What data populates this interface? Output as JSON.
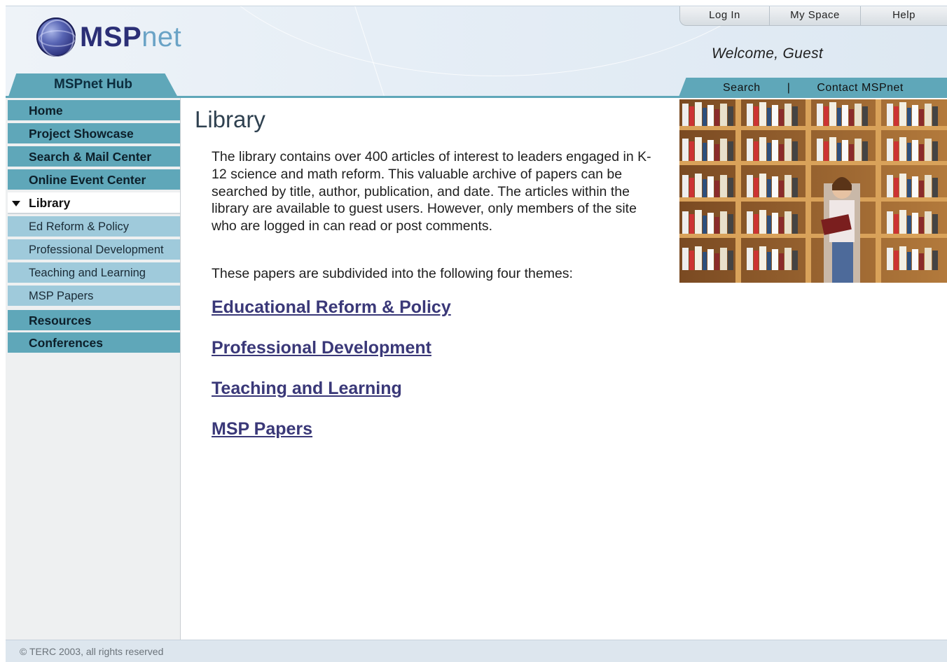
{
  "header": {
    "logo": {
      "prefix": "MSP",
      "suffix": "net"
    },
    "top_links": [
      "Log In",
      "My Space",
      "Help"
    ],
    "welcome": "Welcome, Guest",
    "hub_label": "MSPnet Hub",
    "search_label": "Search",
    "separator": "|",
    "contact_label": "Contact MSPnet"
  },
  "sidebar": {
    "items": [
      {
        "label": "Home",
        "type": "main"
      },
      {
        "label": "Project Showcase",
        "type": "main"
      },
      {
        "label": "Search & Mail Center",
        "type": "main"
      },
      {
        "label": "Online Event Center",
        "type": "main"
      },
      {
        "label": "Library",
        "type": "active"
      },
      {
        "label": "Ed Reform & Policy",
        "type": "sub"
      },
      {
        "label": "Professional Development",
        "type": "sub"
      },
      {
        "label": "Teaching and Learning",
        "type": "sub"
      },
      {
        "label": "MSP Papers",
        "type": "sub"
      },
      {
        "label": "Resources",
        "type": "main"
      },
      {
        "label": "Conferences",
        "type": "main"
      }
    ]
  },
  "main": {
    "title": "Library",
    "intro": "The library contains over 400 articles of interest to leaders engaged in K-12 science and math reform. This valuable archive of papers can be searched by title, author, publication, and date. The articles within the library are available to guest users. However, only members of the site who are logged in can read or post comments.",
    "themes_intro": "These papers are subdivided into the following four themes:",
    "themes": [
      "Educational Reform & Policy",
      "Professional Development",
      "Teaching and Learning",
      "MSP Papers"
    ]
  },
  "footer": {
    "copyright": "© TERC 2003, all rights reserved"
  },
  "colors": {
    "nav_main": "#5fa7b9",
    "nav_sub": "#9fcadb",
    "link": "#3a3878",
    "logo_dark": "#2b2f76",
    "logo_light": "#6aa3c6"
  }
}
